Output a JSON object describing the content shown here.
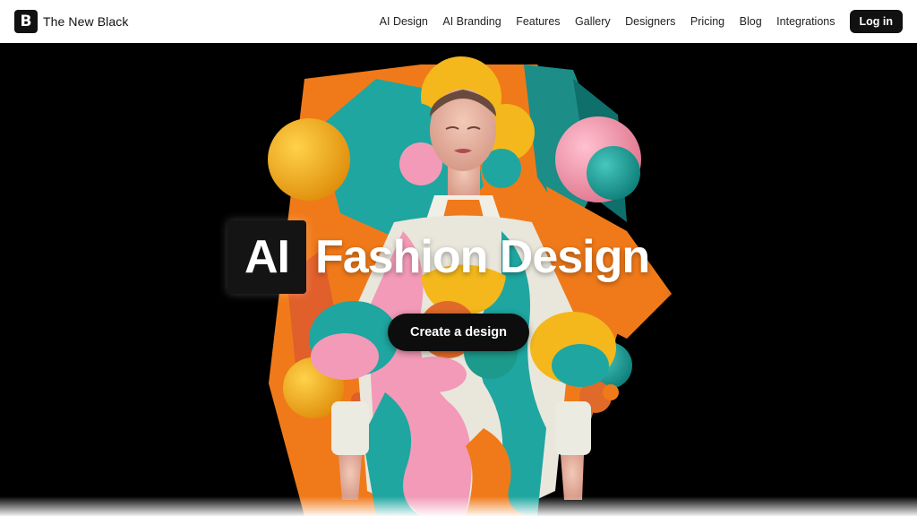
{
  "brand": {
    "logo_glyph": "B",
    "name": "The New Black"
  },
  "nav": {
    "links": [
      "AI Design",
      "AI Branding",
      "Features",
      "Gallery",
      "Designers",
      "Pricing",
      "Blog",
      "Integrations"
    ],
    "login_label": "Log in"
  },
  "hero": {
    "badge_text": "AI",
    "headline": "Fashion Design",
    "cta_label": "Create a design",
    "image_icon": "fashion-artwork-image"
  },
  "colors": {
    "orange": "#f07a1a",
    "teal": "#1fa6a0",
    "yellow": "#f4b81c",
    "pink": "#f29ab8",
    "background": "#000000"
  }
}
